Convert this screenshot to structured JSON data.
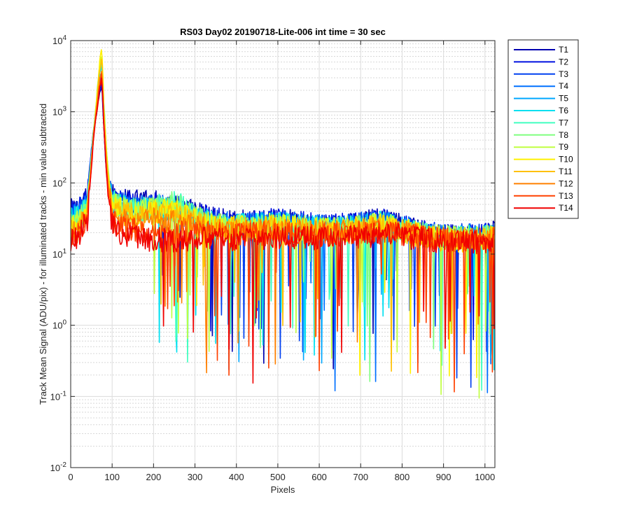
{
  "chart_data": {
    "type": "line",
    "title": "RS03 Day02 20190718-Lite-006 int time = 30 sec",
    "xlabel": "Pixels",
    "ylabel": "Track Mean Signal (ADU/pix) - for illuminated tracks - min value subtracted",
    "xlim": [
      0,
      1024
    ],
    "ylim": [
      0.01,
      10000
    ],
    "yscale": "log",
    "grid": "on (major and minor)",
    "legend_position": "outside top-right",
    "x_ticks": [
      0,
      100,
      200,
      300,
      400,
      500,
      600,
      700,
      800,
      900,
      1000
    ],
    "x_tick_labels": [
      "0",
      "100",
      "200",
      "300",
      "400",
      "500",
      "600",
      "700",
      "800",
      "900",
      "1000"
    ],
    "y_ticks": [
      0.01,
      0.1,
      1,
      10,
      100,
      1000,
      10000
    ],
    "y_tick_labels": [
      {
        "base": "10",
        "exp": "-2"
      },
      {
        "base": "10",
        "exp": "-1"
      },
      {
        "base": "10",
        "exp": "0"
      },
      {
        "base": "10",
        "exp": "1"
      },
      {
        "base": "10",
        "exp": "2"
      },
      {
        "base": "10",
        "exp": "3"
      },
      {
        "base": "10",
        "exp": "4"
      }
    ],
    "x": [
      0,
      20,
      40,
      50,
      55,
      60,
      65,
      70,
      75,
      80,
      85,
      90,
      100,
      120,
      150,
      200,
      250,
      300,
      350,
      400,
      450,
      500,
      550,
      600,
      650,
      700,
      750,
      800,
      850,
      900,
      950,
      1000,
      1024
    ],
    "series": [
      {
        "name": "T1",
        "color": "#0000B0",
        "values": [
          40,
          45,
          60,
          300,
          550,
          800,
          1200,
          1900,
          2500,
          600,
          180,
          90,
          65,
          55,
          55,
          55,
          45,
          40,
          30,
          28,
          28,
          30,
          28,
          25,
          25,
          28,
          30,
          25,
          20,
          18,
          18,
          18,
          20
        ]
      },
      {
        "name": "T2",
        "color": "#0010E0",
        "values": [
          38,
          42,
          55,
          280,
          520,
          800,
          1300,
          2000,
          2700,
          650,
          200,
          95,
          62,
          55,
          50,
          50,
          45,
          38,
          30,
          28,
          28,
          30,
          28,
          25,
          25,
          28,
          30,
          25,
          20,
          18,
          18,
          18,
          20
        ]
      },
      {
        "name": "T3",
        "color": "#0040F0",
        "values": [
          36,
          40,
          52,
          270,
          520,
          820,
          1400,
          2200,
          3000,
          700,
          220,
          100,
          60,
          52,
          48,
          48,
          42,
          36,
          28,
          26,
          26,
          28,
          26,
          24,
          24,
          26,
          28,
          24,
          20,
          18,
          18,
          18,
          19
        ]
      },
      {
        "name": "T4",
        "color": "#0070FF",
        "values": [
          34,
          38,
          50,
          260,
          510,
          830,
          1500,
          2500,
          3500,
          750,
          240,
          110,
          58,
          50,
          46,
          46,
          40,
          34,
          27,
          26,
          26,
          28,
          26,
          24,
          24,
          26,
          28,
          24,
          20,
          18,
          18,
          18,
          19
        ]
      },
      {
        "name": "T5",
        "color": "#00A8FF",
        "values": [
          32,
          36,
          48,
          250,
          500,
          850,
          1700,
          2900,
          4000,
          850,
          260,
          120,
          56,
          48,
          44,
          44,
          40,
          33,
          26,
          25,
          25,
          27,
          25,
          23,
          23,
          25,
          27,
          23,
          19,
          17,
          17,
          17,
          18
        ]
      },
      {
        "name": "T6",
        "color": "#00E0F0",
        "values": [
          30,
          34,
          46,
          240,
          500,
          880,
          1900,
          3300,
          4600,
          950,
          300,
          130,
          55,
          47,
          43,
          43,
          40,
          32,
          26,
          25,
          25,
          27,
          25,
          23,
          23,
          25,
          27,
          23,
          19,
          17,
          17,
          17,
          18
        ]
      },
      {
        "name": "T7",
        "color": "#40FFC0",
        "values": [
          28,
          32,
          44,
          240,
          520,
          950,
          2200,
          3800,
          5500,
          1200,
          350,
          150,
          55,
          46,
          42,
          45,
          55,
          34,
          26,
          25,
          25,
          26,
          24,
          22,
          22,
          24,
          26,
          22,
          19,
          17,
          17,
          17,
          18
        ]
      },
      {
        "name": "T8",
        "color": "#80FF80",
        "values": [
          26,
          30,
          42,
          230,
          520,
          980,
          2400,
          4300,
          6500,
          1400,
          400,
          160,
          54,
          45,
          41,
          44,
          52,
          33,
          25,
          24,
          24,
          26,
          24,
          22,
          22,
          24,
          26,
          22,
          19,
          17,
          17,
          17,
          18
        ]
      },
      {
        "name": "T9",
        "color": "#C0FF40",
        "values": [
          24,
          28,
          40,
          220,
          500,
          950,
          2300,
          4500,
          7000,
          1300,
          380,
          150,
          52,
          44,
          40,
          42,
          45,
          32,
          25,
          24,
          24,
          26,
          24,
          22,
          22,
          24,
          26,
          22,
          18,
          17,
          17,
          17,
          18
        ]
      },
      {
        "name": "T10",
        "color": "#FFF000",
        "values": [
          22,
          26,
          38,
          210,
          480,
          900,
          2200,
          4800,
          7800,
          1200,
          360,
          140,
          50,
          42,
          38,
          40,
          42,
          30,
          24,
          23,
          23,
          25,
          23,
          22,
          22,
          23,
          25,
          22,
          18,
          16,
          16,
          16,
          17
        ]
      },
      {
        "name": "T11",
        "color": "#FFC000",
        "values": [
          20,
          24,
          36,
          200,
          460,
          850,
          1900,
          3800,
          6000,
          1000,
          300,
          120,
          45,
          38,
          35,
          36,
          35,
          28,
          23,
          22,
          22,
          24,
          22,
          21,
          21,
          22,
          24,
          21,
          18,
          16,
          16,
          16,
          17
        ]
      },
      {
        "name": "T12",
        "color": "#FF8000",
        "values": [
          18,
          22,
          34,
          190,
          440,
          800,
          1500,
          2800,
          4200,
          800,
          240,
          100,
          38,
          32,
          30,
          30,
          28,
          25,
          22,
          21,
          21,
          23,
          21,
          20,
          20,
          21,
          23,
          20,
          17,
          16,
          16,
          16,
          17
        ]
      },
      {
        "name": "T13",
        "color": "#FF4000",
        "values": [
          16,
          20,
          32,
          180,
          420,
          750,
          1300,
          2300,
          3400,
          700,
          200,
          80,
          30,
          25,
          22,
          20,
          20,
          20,
          19,
          19,
          19,
          20,
          19,
          19,
          19,
          20,
          21,
          19,
          17,
          16,
          16,
          16,
          17
        ]
      },
      {
        "name": "T14",
        "color": "#F00000",
        "values": [
          15,
          18,
          30,
          170,
          400,
          700,
          1200,
          2100,
          3100,
          650,
          180,
          70,
          25,
          20,
          17,
          16,
          16,
          16,
          16,
          16,
          16,
          17,
          17,
          17,
          17,
          18,
          19,
          18,
          16,
          15,
          15,
          15,
          16
        ]
      }
    ]
  }
}
